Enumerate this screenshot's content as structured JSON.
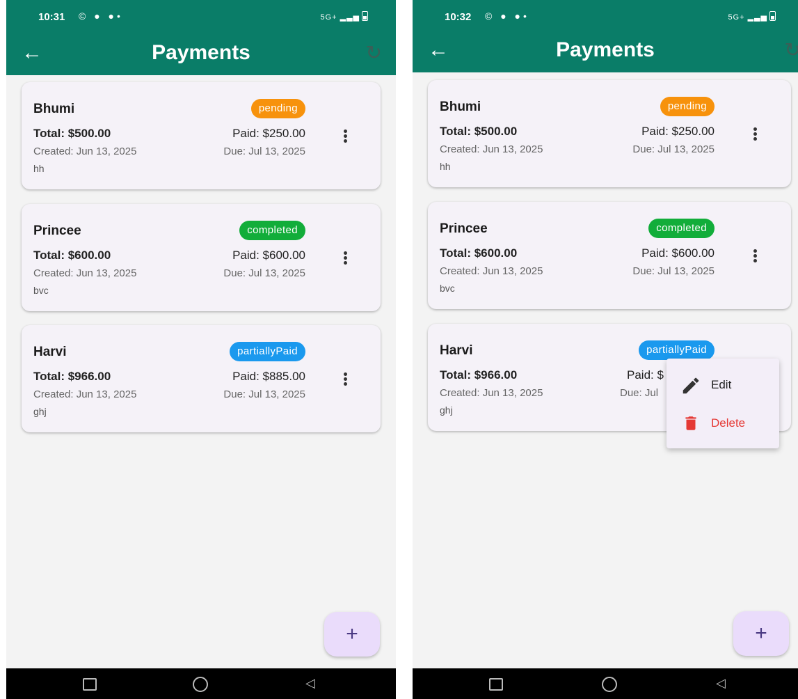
{
  "left_screen": {
    "status": {
      "time": "10:31",
      "left_icons": "© ● ●•",
      "right_icons": "5G+"
    },
    "app_bar": {
      "title": "Payments"
    },
    "payments": [
      {
        "name": "Bhumi",
        "status": "pending",
        "total": "Total: $500.00",
        "paid": "Paid: $250.00",
        "created": "Created: Jun 13, 2025",
        "due": "Due: Jul 13, 2025",
        "note": "hh"
      },
      {
        "name": "Princee",
        "status": "completed",
        "total": "Total: $600.00",
        "paid": "Paid: $600.00",
        "created": "Created: Jun 13, 2025",
        "due": "Due: Jul 13, 2025",
        "note": "bvc"
      },
      {
        "name": "Harvi",
        "status": "partiallyPaid",
        "total": "Total: $966.00",
        "paid": "Paid: $885.00",
        "created": "Created: Jun 13, 2025",
        "due": "Due: Jul 13, 2025",
        "note": "ghj"
      }
    ],
    "fab_label": "+"
  },
  "right_screen": {
    "status": {
      "time": "10:32",
      "left_icons": "© ● ●•",
      "right_icons": "5G+"
    },
    "app_bar": {
      "title": "Payments"
    },
    "payments": [
      {
        "name": "Bhumi",
        "status": "pending",
        "total": "Total: $500.00",
        "paid": "Paid: $250.00",
        "created": "Created: Jun 13, 2025",
        "due": "Due: Jul 13, 2025",
        "note": "hh"
      },
      {
        "name": "Princee",
        "status": "completed",
        "total": "Total: $600.00",
        "paid": "Paid: $600.00",
        "created": "Created: Jun 13, 2025",
        "due": "Due: Jul 13, 2025",
        "note": "bvc"
      },
      {
        "name": "Harvi",
        "status": "partiallyPaid",
        "total": "Total: $966.00",
        "paid": "Paid: $",
        "created": "Created: Jun 13, 2025",
        "due": "Due: Jul",
        "note": "ghj"
      }
    ],
    "popup_menu": {
      "edit_label": "Edit",
      "delete_label": "Delete"
    },
    "fab_label": "+"
  },
  "icons": {
    "back": "arrow-left-icon",
    "refresh": "refresh-icon",
    "more": "more-vert-icon",
    "edit": "pencil-icon",
    "delete": "trash-icon",
    "add": "plus-icon"
  },
  "colors": {
    "app_bar": "#0a7d68",
    "pending": "#f7920c",
    "completed": "#12ad3a",
    "partiallyPaid": "#1a99ee",
    "delete": "#e53935",
    "fab": "#eadcfb"
  }
}
